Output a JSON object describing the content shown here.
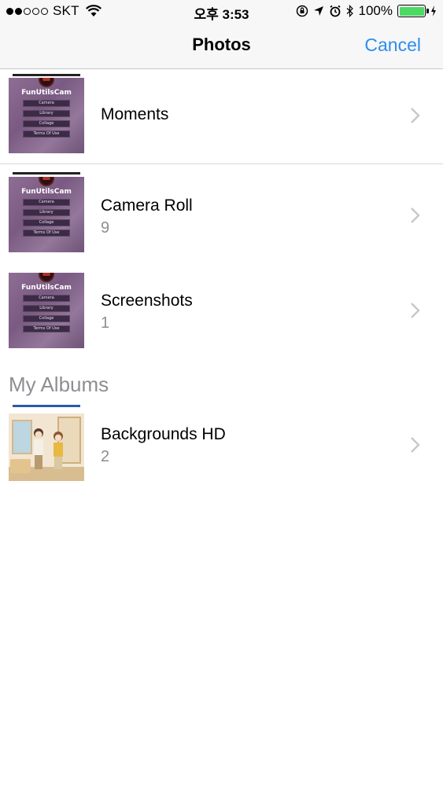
{
  "status_bar": {
    "carrier": "SKT",
    "time": "오후 3:53",
    "battery": "100%",
    "signal_bars_filled": 2,
    "signal_bars_total": 5,
    "battery_level": 1.0,
    "battery_color": "#4cd964",
    "icons": [
      "wifi-icon",
      "orientation-lock-icon",
      "location-icon",
      "alarm-icon",
      "bluetooth-icon",
      "charging-icon"
    ]
  },
  "nav": {
    "title": "Photos",
    "cancel": "Cancel",
    "accent_color": "#2d8cf0"
  },
  "albums": [
    {
      "title": "Moments",
      "count": ""
    },
    {
      "title": "Camera Roll",
      "count": "9"
    },
    {
      "title": "Screenshots",
      "count": "1"
    }
  ],
  "my_albums": {
    "header": "My Albums",
    "items": [
      {
        "title": "Backgrounds HD",
        "count": "2"
      }
    ]
  },
  "thumbnail_app": {
    "brand": "FunUtilsCam",
    "buttons": [
      "Camera",
      "Library",
      "Collage",
      "Terms Of Use"
    ]
  }
}
